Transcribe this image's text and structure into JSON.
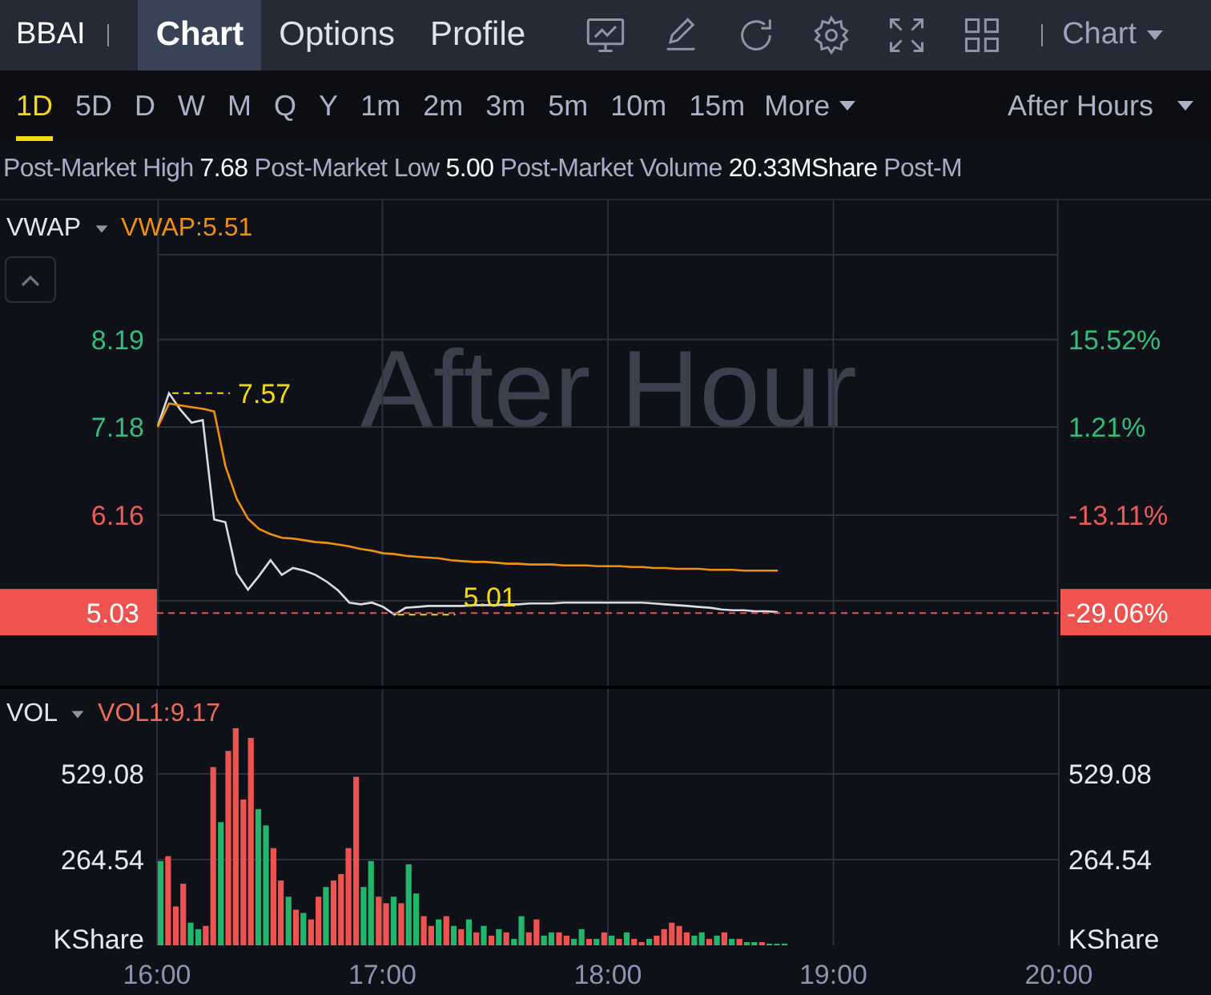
{
  "header": {
    "symbol": "BBAI",
    "tabs": [
      {
        "label": "Chart",
        "selected": true
      },
      {
        "label": "Options",
        "selected": false
      },
      {
        "label": "Profile",
        "selected": false
      }
    ],
    "chart_menu": "Chart"
  },
  "periods": [
    {
      "label": "1D",
      "selected": true
    },
    {
      "label": "5D",
      "selected": false
    },
    {
      "label": "D",
      "selected": false
    },
    {
      "label": "W",
      "selected": false
    },
    {
      "label": "M",
      "selected": false
    },
    {
      "label": "Q",
      "selected": false
    },
    {
      "label": "Y",
      "selected": false
    },
    {
      "label": "1m",
      "selected": false
    },
    {
      "label": "2m",
      "selected": false
    },
    {
      "label": "3m",
      "selected": false
    },
    {
      "label": "5m",
      "selected": false
    },
    {
      "label": "10m",
      "selected": false
    },
    {
      "label": "15m",
      "selected": false
    }
  ],
  "more_menu": "More",
  "session_menu": "After Hours",
  "stats_line": [
    {
      "label": "Post-Market High",
      "value": "7.68"
    },
    {
      "label": "Post-Market Low",
      "value": "5.00"
    },
    {
      "label": "Post-Market Volume",
      "value": "20.33MShare"
    },
    {
      "label": "Post-M"
    }
  ],
  "price_panel": {
    "indicator": "VWAP",
    "indicator_value": "VWAP:5.51",
    "background_label": "After Hour",
    "last_change": "-29.06%",
    "right_axis": [
      {
        "label": "15.52%",
        "color": "#2fbf7a"
      },
      {
        "label": "1.21%",
        "color": "#2fbf7a"
      },
      {
        "label": "-13.11%",
        "color": "#ee5a57"
      }
    ],
    "chart_data": {
      "type": "line",
      "grid": true,
      "categories": [
        null,
        null,
        null,
        null,
        null,
        null,
        null,
        null,
        null,
        null,
        null,
        null,
        null,
        null,
        null,
        null,
        null,
        null,
        null,
        null,
        null,
        null,
        null,
        null,
        null,
        null,
        null,
        null,
        null,
        null,
        null,
        null,
        null,
        null,
        null,
        null,
        null,
        null,
        null,
        null,
        null,
        null,
        null,
        null,
        null,
        null,
        null,
        null,
        null,
        null,
        null,
        null,
        null,
        null,
        null,
        null
      ],
      "series": [
        {
          "color": "#d9dce3",
          "values": [
            7.19,
            7.57,
            7.38,
            7.23,
            7.26,
            6.11,
            6.08,
            5.49,
            5.3,
            5.46,
            5.64,
            5.47,
            5.55,
            5.52,
            5.47,
            5.39,
            5.29,
            5.15,
            5.13,
            5.15,
            5.1,
            5.01,
            5.09,
            5.1,
            5.11,
            5.11,
            5.11,
            5.11,
            5.12,
            5.12,
            5.12,
            5.13,
            5.13,
            5.14,
            5.14,
            5.14,
            5.15,
            5.15,
            5.15,
            5.15,
            5.15,
            5.15,
            5.15,
            5.15,
            5.14,
            5.13,
            5.12,
            5.11,
            5.1,
            5.09,
            5.07,
            5.06,
            5.06,
            5.05,
            5.05,
            5.04
          ]
        },
        {
          "color": "#f0900a",
          "values": [
            7.18,
            7.45,
            7.43,
            7.41,
            7.39,
            7.36,
            6.73,
            6.35,
            6.12,
            6,
            5.94,
            5.9,
            5.89,
            5.87,
            5.85,
            5.84,
            5.82,
            5.8,
            5.77,
            5.75,
            5.72,
            5.71,
            5.69,
            5.68,
            5.67,
            5.66,
            5.64,
            5.63,
            5.62,
            5.62,
            5.61,
            5.6,
            5.6,
            5.59,
            5.59,
            5.59,
            5.58,
            5.58,
            5.58,
            5.57,
            5.57,
            5.57,
            5.56,
            5.56,
            5.55,
            5.55,
            5.54,
            5.54,
            5.54,
            5.53,
            5.53,
            5.53,
            5.52,
            5.52,
            5.52,
            5.52
          ]
        }
      ],
      "ylim": [
        4.17,
        9.8
      ],
      "yticks": [
        {
          "value": 8.19,
          "label": "8.19"
        },
        {
          "value": 7.18,
          "label": "7.18"
        },
        {
          "value": 6.16,
          "label": "6.16"
        },
        {
          "value": 5.03,
          "label": "5.03"
        }
      ],
      "annotations": [
        "7.57",
        "5.01"
      ],
      "ref_lines": [
        {
          "axis": "y",
          "value": 5.03,
          "color": "#ef5350"
        }
      ]
    }
  },
  "volume_panel": {
    "indicator": "VOL",
    "indicator_value": "VOL1:9.17",
    "chart_data": {
      "type": "bar",
      "stacked": true,
      "grid": true,
      "x": [
        16,
        16.033,
        16.067,
        16.1,
        16.133,
        16.167,
        16.2,
        16.233,
        16.267,
        16.3,
        16.333,
        16.367,
        16.4,
        16.433,
        16.467,
        16.5,
        16.533,
        16.567,
        16.6,
        16.633,
        16.667,
        16.7,
        16.733,
        16.767,
        16.8,
        16.833,
        16.867,
        16.9,
        16.933,
        16.967,
        17,
        17.033,
        17.067,
        17.1,
        17.133,
        17.167,
        17.2,
        17.233,
        17.267,
        17.3,
        17.333,
        17.367,
        17.4,
        17.433,
        17.467,
        17.5,
        17.533,
        17.567,
        17.6,
        17.633,
        17.667,
        17.7,
        17.733,
        17.767,
        17.8,
        17.833,
        17.867,
        17.9,
        17.933,
        17.967,
        18,
        18.033,
        18.067,
        18.1,
        18.133,
        18.167,
        18.2,
        18.233,
        18.267,
        18.3,
        18.333,
        18.367,
        18.4,
        18.433,
        18.467,
        18.5,
        18.533,
        18.567,
        18.6,
        18.633,
        18.667,
        18.7,
        18.733,
        18.767
      ],
      "series": [
        {
          "color": "#22b56c",
          "values": [
            260,
            null,
            null,
            null,
            70,
            50,
            null,
            null,
            380,
            null,
            null,
            null,
            null,
            420,
            370,
            null,
            null,
            150,
            null,
            100,
            null,
            null,
            180,
            null,
            null,
            null,
            null,
            180,
            260,
            null,
            null,
            150,
            null,
            250,
            160,
            null,
            null,
            80,
            null,
            60,
            null,
            80,
            null,
            60,
            null,
            50,
            null,
            20,
            90,
            null,
            null,
            30,
            40,
            null,
            null,
            20,
            50,
            null,
            20,
            null,
            30,
            null,
            40,
            null,
            null,
            20,
            null,
            null,
            null,
            null,
            null,
            30,
            40,
            null,
            30,
            null,
            20,
            null,
            10,
            10,
            null,
            5,
            5,
            5
          ]
        },
        {
          "color": "#ef5350",
          "values": [
            null,
            275,
            120,
            190,
            null,
            null,
            60,
            550,
            null,
            600,
            670,
            450,
            640,
            null,
            null,
            300,
            200,
            null,
            110,
            null,
            80,
            150,
            null,
            200,
            220,
            300,
            520,
            null,
            null,
            150,
            130,
            null,
            130,
            null,
            null,
            90,
            60,
            null,
            90,
            null,
            50,
            null,
            40,
            null,
            30,
            null,
            40,
            null,
            null,
            40,
            80,
            null,
            null,
            40,
            30,
            null,
            null,
            20,
            null,
            40,
            null,
            20,
            null,
            20,
            10,
            null,
            30,
            50,
            70,
            60,
            40,
            null,
            null,
            20,
            null,
            40,
            null,
            20,
            null,
            null,
            10,
            null,
            null,
            null
          ]
        }
      ],
      "xlim": [
        16,
        20
      ],
      "ylim": [
        0,
        791
      ],
      "y2lim": [
        0,
        791
      ],
      "xticks": [
        {
          "value": 16,
          "label": "16:00"
        },
        {
          "value": 17,
          "label": "17:00"
        },
        {
          "value": 18,
          "label": "18:00"
        },
        {
          "value": 19,
          "label": "19:00"
        },
        {
          "value": 20,
          "label": "20:00"
        }
      ],
      "yticks": [
        {
          "value": 0,
          "label": "KShare"
        },
        {
          "value": 264.54,
          "label": "264.54"
        },
        {
          "value": 529.08,
          "label": "529.08"
        }
      ],
      "y2ticks": [
        {
          "value": 0,
          "label": "KShare"
        },
        {
          "value": 264.54,
          "label": "264.54"
        },
        {
          "value": 529.08,
          "label": "529.08"
        }
      ]
    }
  }
}
